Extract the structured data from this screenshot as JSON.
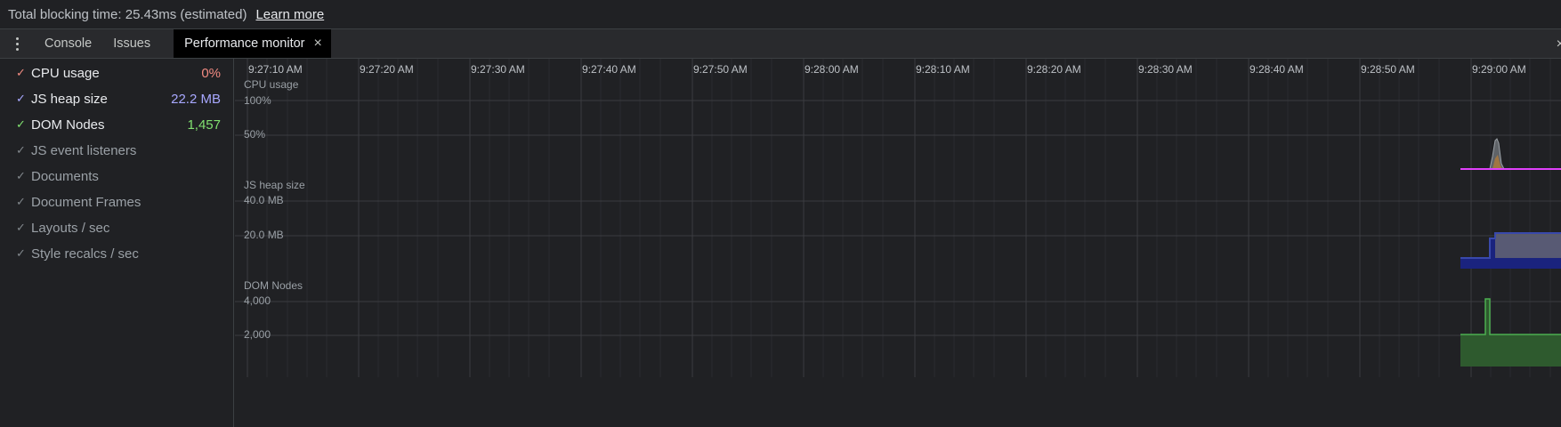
{
  "status": {
    "text": "Total blocking time: 25.43ms (estimated)",
    "link": "Learn more"
  },
  "tabs": {
    "console": "Console",
    "issues": "Issues",
    "active": "Performance monitor",
    "close_glyph": "×"
  },
  "metrics": [
    {
      "label": "CPU usage",
      "value": "0%",
      "checked": true,
      "color": "#f28b82"
    },
    {
      "label": "JS heap size",
      "value": "22.2 MB",
      "checked": true,
      "color": "#a8a8ff"
    },
    {
      "label": "DOM Nodes",
      "value": "1,457",
      "checked": true,
      "color": "#81e070"
    },
    {
      "label": "JS event listeners",
      "value": "",
      "checked": false
    },
    {
      "label": "Documents",
      "value": "",
      "checked": false
    },
    {
      "label": "Document Frames",
      "value": "",
      "checked": false
    },
    {
      "label": "Layouts / sec",
      "value": "",
      "checked": false
    },
    {
      "label": "Style recalcs / sec",
      "value": "",
      "checked": false
    }
  ],
  "timeline": {
    "times": [
      "9:27:10 AM",
      "9:27:20 AM",
      "9:27:30 AM",
      "9:27:40 AM",
      "9:27:50 AM",
      "9:28:00 AM",
      "9:28:10 AM",
      "9:28:20 AM",
      "9:28:30 AM",
      "9:28:40 AM",
      "9:28:50 AM",
      "9:29:00 AM"
    ],
    "charts": [
      {
        "title": "CPU usage",
        "axis": [
          "100%",
          "50%"
        ]
      },
      {
        "title": "JS heap size",
        "axis": [
          "40.0 MB",
          "20.0 MB"
        ]
      },
      {
        "title": "DOM Nodes",
        "axis": [
          "4,000",
          "2,000"
        ]
      }
    ]
  },
  "colors": {
    "cpu_line": "#e040fb",
    "heap_fill": "#1a237e",
    "heap_line": "#3949ab",
    "heap_upper": "#5f6173",
    "dom_fill": "#2e5a2e",
    "dom_line": "#4caf50"
  }
}
